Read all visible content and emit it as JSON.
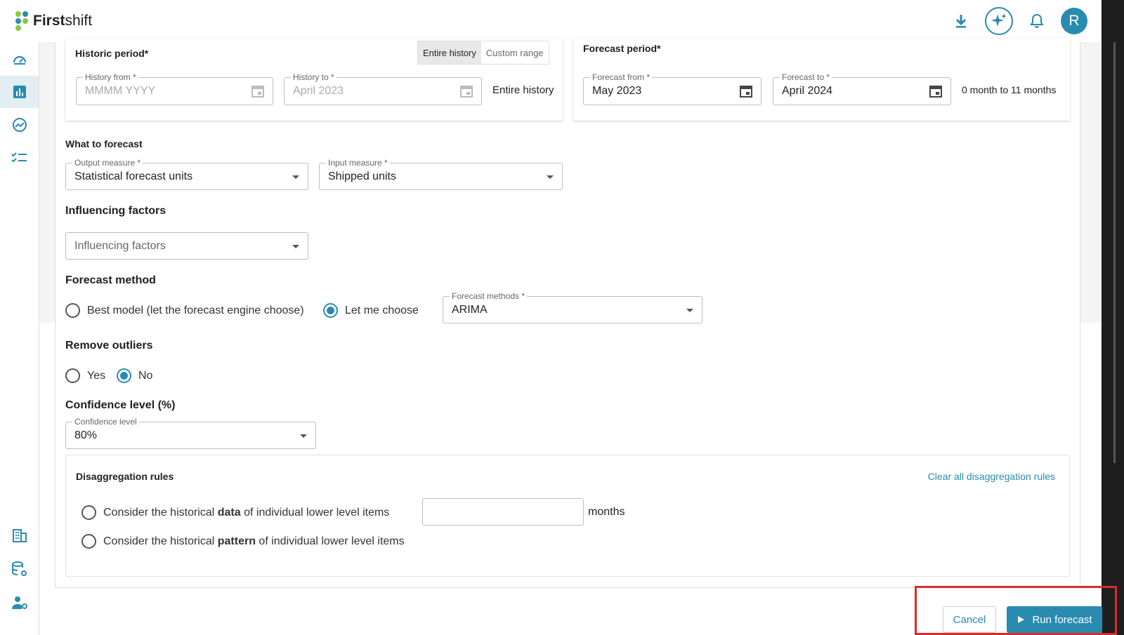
{
  "app": {
    "logo_bold": "First",
    "logo_rest": "shift",
    "avatar_initial": "R",
    "accent": "#2a8bb0"
  },
  "topbar": {
    "icons": [
      "download-icon",
      "ai-sparkle-icon",
      "bell-icon"
    ]
  },
  "sidebar": {
    "items": [
      "dashboard-icon",
      "bar-chart-icon",
      "trend-icon",
      "checklist-icon",
      "building-icon",
      "database-settings-icon",
      "user-settings-icon"
    ],
    "active": "bar-chart-icon"
  },
  "historic": {
    "title": "Historic period*",
    "segments": [
      "Entire history",
      "Custom range"
    ],
    "selected_segment": "Entire history",
    "from": {
      "label": "History from *",
      "placeholder": "MMMM YYYY"
    },
    "to": {
      "label": "History to *",
      "value": "April 2023"
    },
    "summary": "Entire history"
  },
  "forecast_period": {
    "title": "Forecast period*",
    "from": {
      "label": "Forecast from *",
      "value": "May 2023"
    },
    "to": {
      "label": "Forecast to *",
      "value": "April 2024"
    },
    "summary": "0 month to 11 months"
  },
  "what_to_forecast": {
    "title": "What to forecast",
    "output": {
      "label": "Output measure *",
      "value": "Statistical forecast units"
    },
    "input": {
      "label": "Input measure *",
      "value": "Shipped units"
    }
  },
  "influencing": {
    "title": "Influencing factors",
    "placeholder": "Influencing factors"
  },
  "method": {
    "title": "Forecast method",
    "options": [
      "Best model (let the forecast engine choose)",
      "Let me choose"
    ],
    "selected": "Let me choose",
    "methods": {
      "label": "Forecast methods *",
      "value": "ARIMA"
    }
  },
  "outliers": {
    "title": "Remove outliers",
    "options": [
      "Yes",
      "No"
    ],
    "selected": "No"
  },
  "confidence": {
    "title": "Confidence level (%)",
    "label": "Confidence level",
    "value": "80%"
  },
  "disaggregation": {
    "title": "Disaggregation rules",
    "clear_link": "Clear all disaggregation rules",
    "rule1": {
      "pre": "Consider the historical ",
      "bold": "data",
      "post": " of individual lower level items"
    },
    "rule2": {
      "pre": "Consider the historical ",
      "bold": "pattern",
      "post": " of individual lower level items"
    },
    "months_input": "",
    "months_unit": "months"
  },
  "actions": {
    "cancel": "Cancel",
    "run": "Run forecast"
  }
}
